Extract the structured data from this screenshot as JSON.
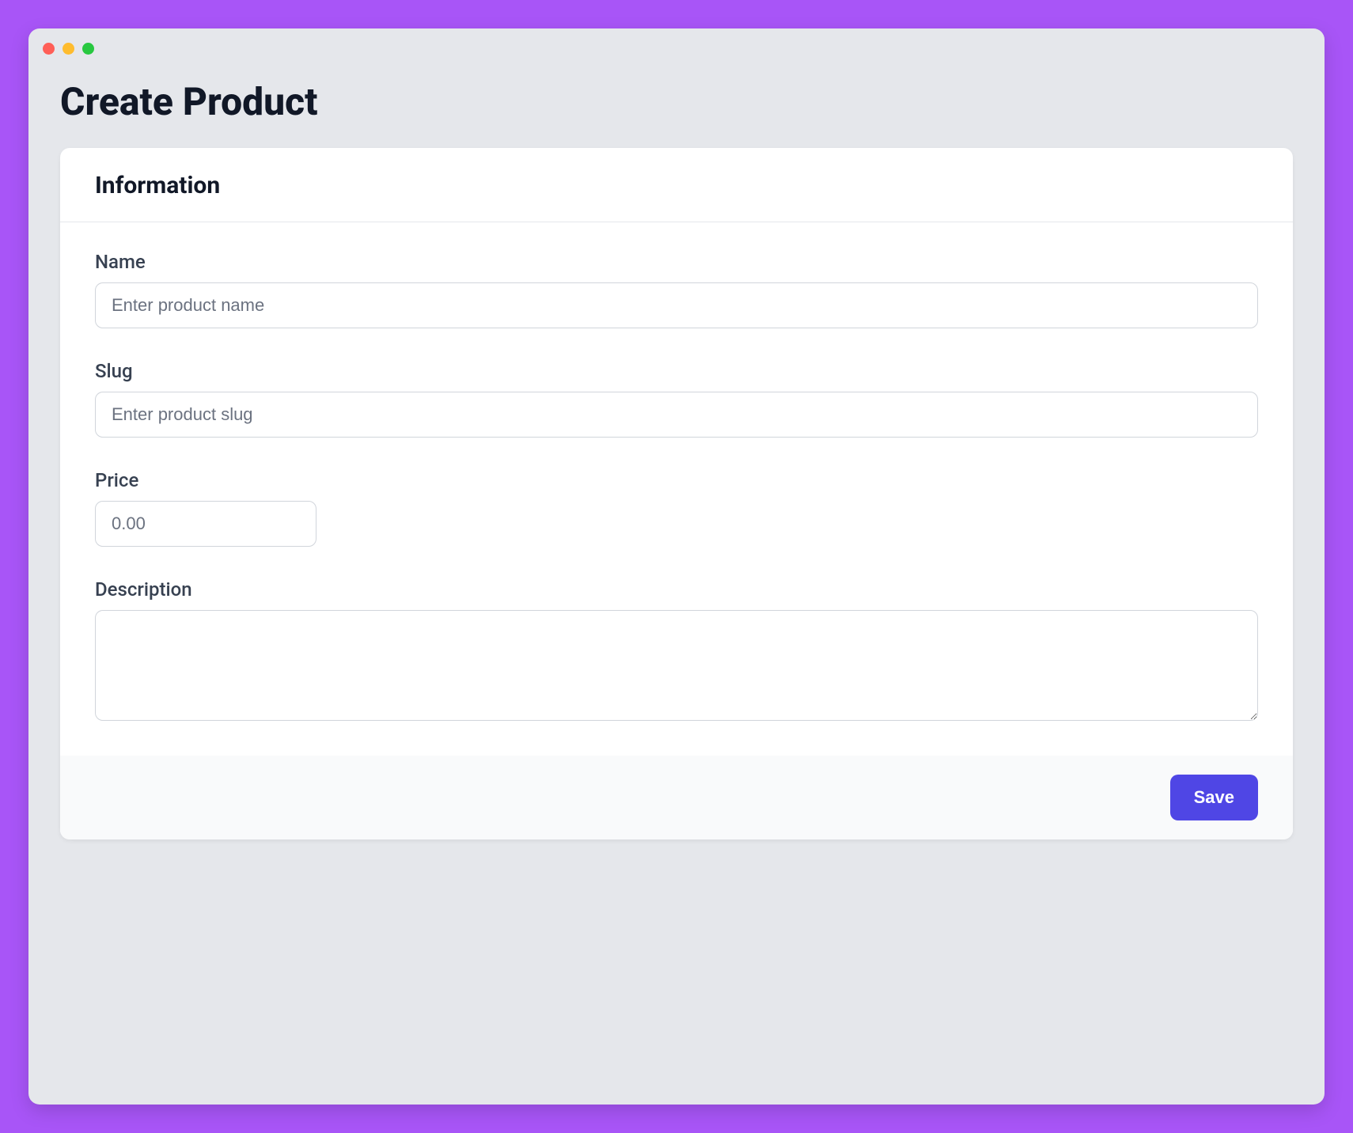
{
  "page": {
    "title": "Create Product"
  },
  "card": {
    "header": "Information"
  },
  "form": {
    "name": {
      "label": "Name",
      "placeholder": "Enter product name",
      "value": ""
    },
    "slug": {
      "label": "Slug",
      "placeholder": "Enter product slug",
      "value": ""
    },
    "price": {
      "label": "Price",
      "placeholder": "0.00",
      "value": ""
    },
    "description": {
      "label": "Description",
      "placeholder": "",
      "value": ""
    }
  },
  "actions": {
    "save_label": "Save"
  },
  "colors": {
    "accent": "#4f46e5",
    "page_background": "#a855f7",
    "window_background": "#e5e7eb"
  }
}
